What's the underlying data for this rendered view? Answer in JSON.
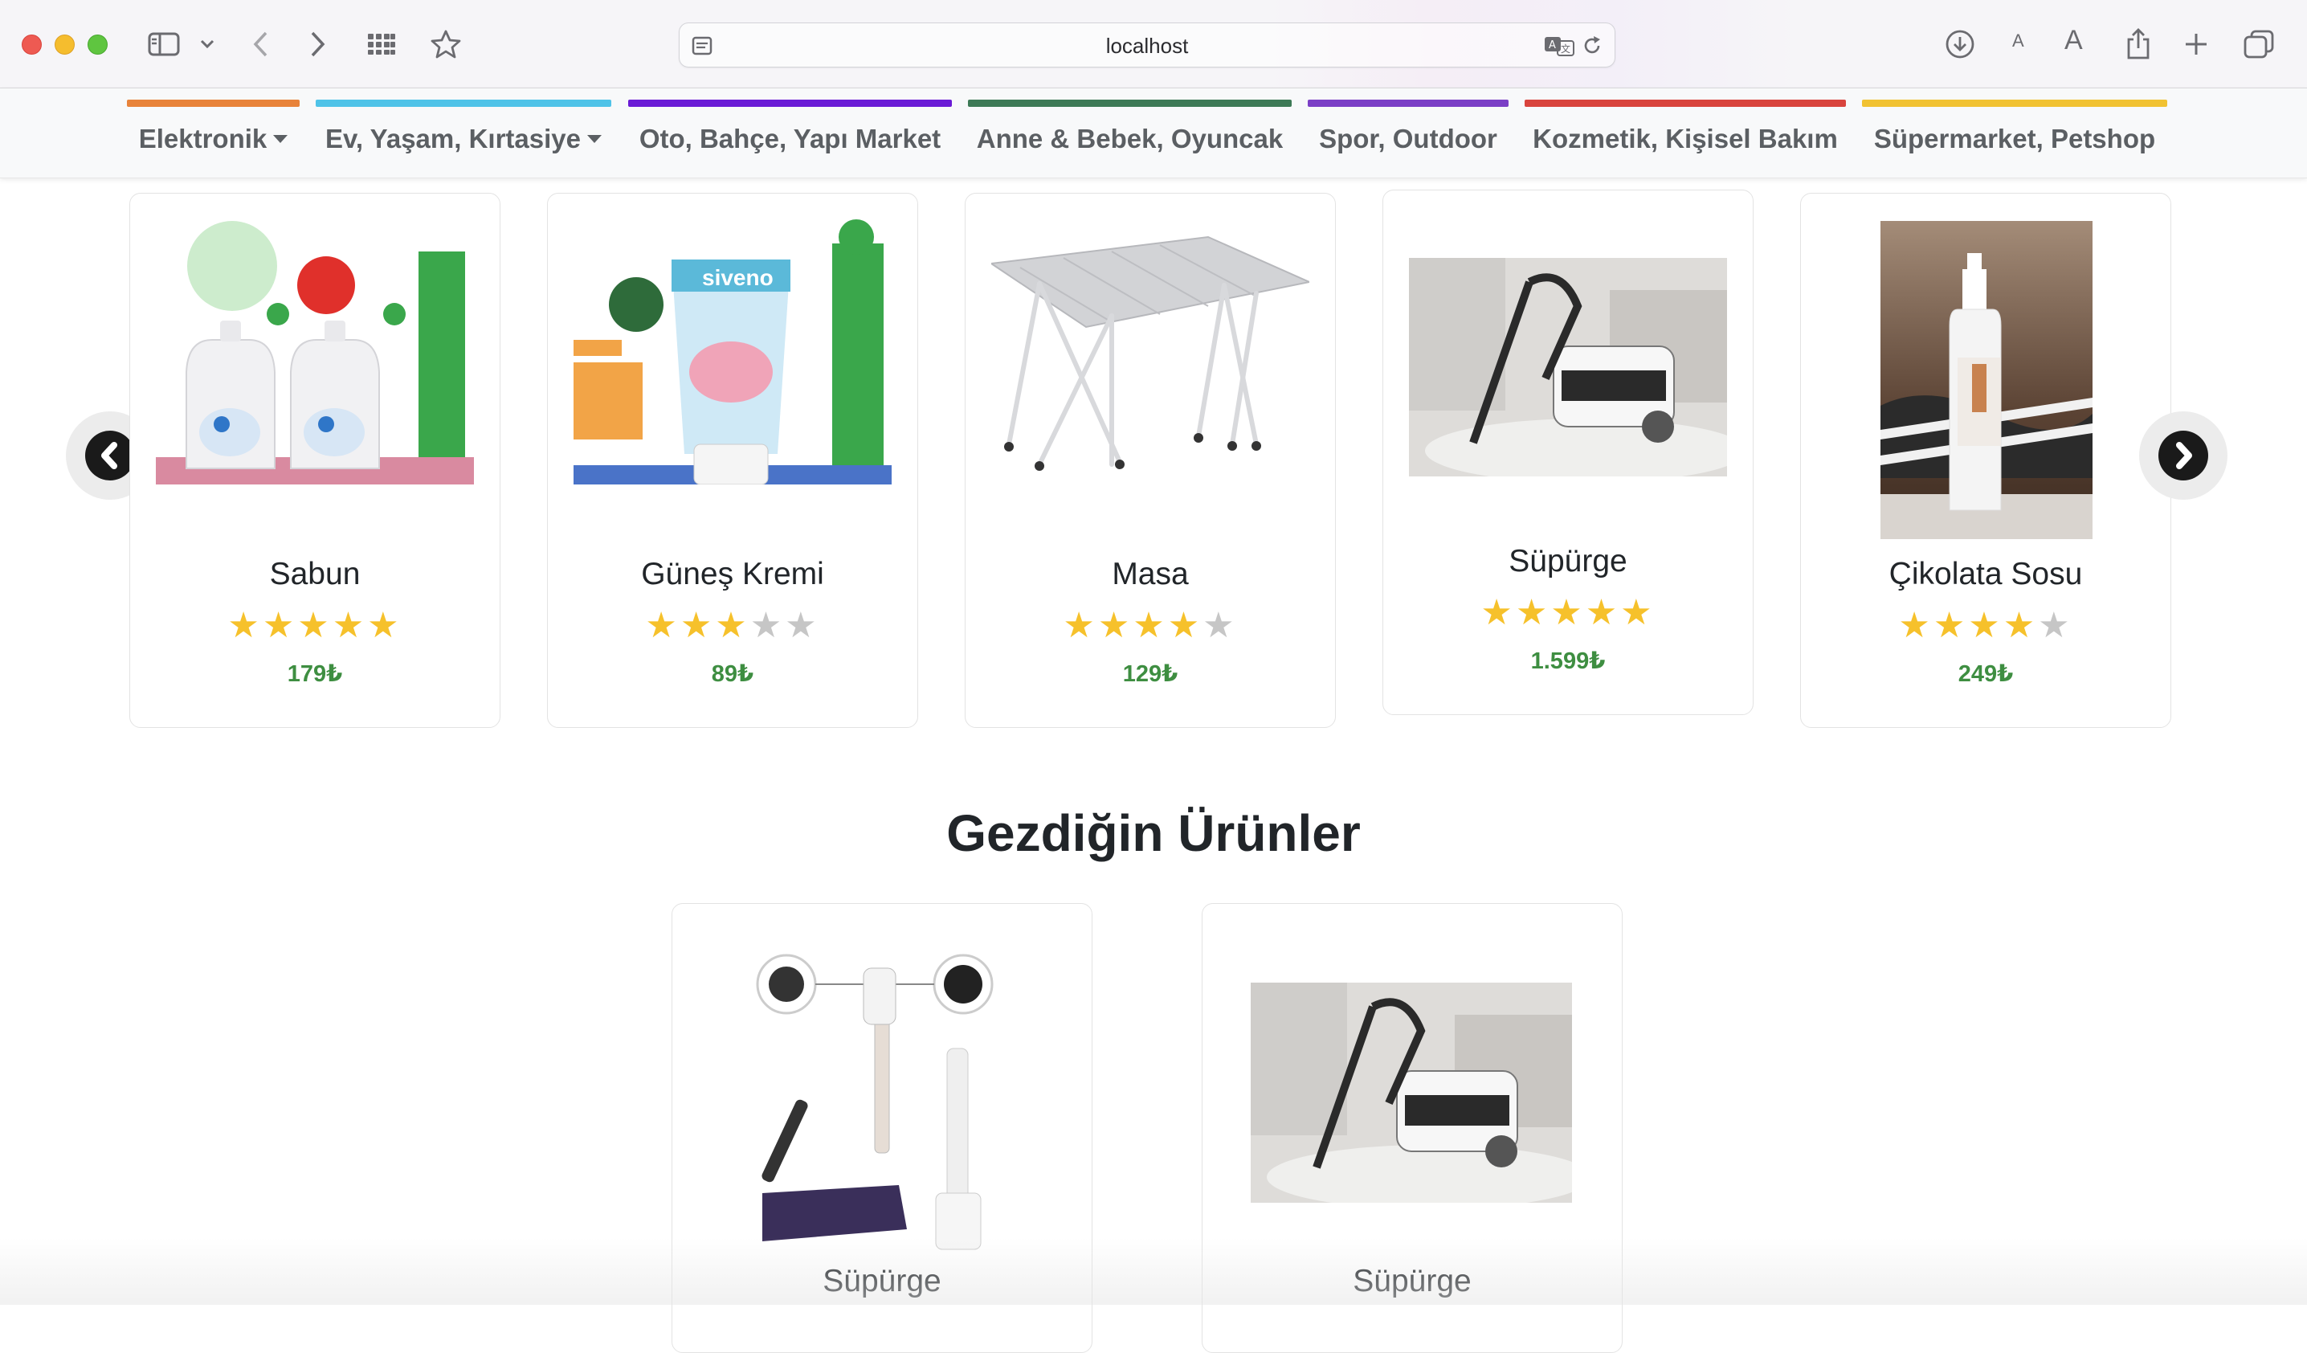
{
  "browser": {
    "address": "localhost",
    "font_small_label": "A",
    "font_large_label": "A"
  },
  "categories": [
    {
      "label": "Elektronik",
      "color": "#e8833a",
      "has_dropdown": true
    },
    {
      "label": "Ev, Yaşam, Kırtasiye",
      "color": "#4fc3e8",
      "has_dropdown": true
    },
    {
      "label": "Oto, Bahçe, Yapı Market",
      "color": "#6a1bd6",
      "has_dropdown": false
    },
    {
      "label": "Anne & Bebek, Oyuncak",
      "color": "#3d7a56",
      "has_dropdown": false
    },
    {
      "label": "Spor, Outdoor",
      "color": "#7b3fc6",
      "has_dropdown": false
    },
    {
      "label": "Kozmetik, Kişisel Bakım",
      "color": "#d9443d",
      "has_dropdown": false
    },
    {
      "label": "Süpermarket, Petshop",
      "color": "#f1c232",
      "has_dropdown": false
    }
  ],
  "carousel": {
    "products": [
      {
        "name": "Sabun",
        "rating": 5,
        "price": "179₺",
        "image": "detergent-bottles"
      },
      {
        "name": "Güneş Kremi",
        "rating": 3,
        "price": "89₺",
        "image": "sunscreen-tube"
      },
      {
        "name": "Masa",
        "rating": 4,
        "price": "129₺",
        "image": "folding-table"
      },
      {
        "name": "Süpürge",
        "rating": 5,
        "price": "1.599₺",
        "image": "wet-vacuum"
      },
      {
        "name": "Çikolata Sosu",
        "rating": 4,
        "price": "249₺",
        "image": "sauce-bottle"
      }
    ],
    "prev_icon": "chevron-left-icon",
    "next_icon": "chevron-right-icon"
  },
  "visited": {
    "title": "Gezdiğin Ürünler",
    "products": [
      {
        "name": "Süpürge",
        "image": "stick-vacuum"
      },
      {
        "name": "Süpürge",
        "image": "wet-vacuum"
      }
    ]
  },
  "colors": {
    "price": "#3e8e41",
    "star_on": "#f6c12b",
    "star_off": "#c6c6c6"
  }
}
